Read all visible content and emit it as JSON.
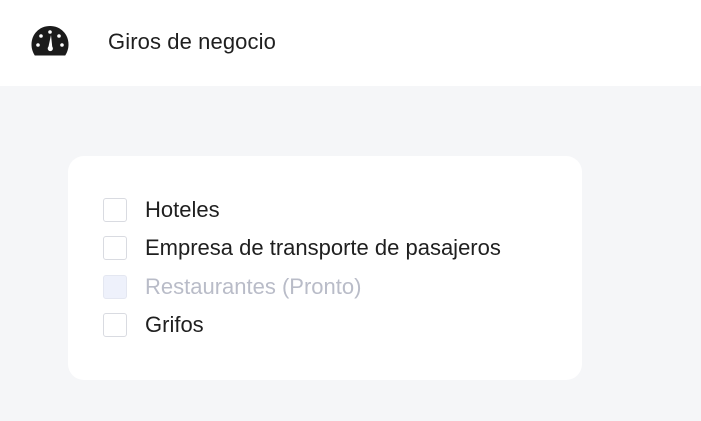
{
  "header": {
    "logo_icon": "speedometer-icon",
    "title": "Giros de negocio"
  },
  "options": [
    {
      "label": "Hoteles",
      "checked": false,
      "disabled": false
    },
    {
      "label": "Empresa de transporte de pasajeros",
      "checked": false,
      "disabled": false
    },
    {
      "label": "Restaurantes (Pronto)",
      "checked": false,
      "disabled": true
    },
    {
      "label": "Grifos",
      "checked": false,
      "disabled": false
    }
  ],
  "colors": {
    "page_background": "#f5f6f8",
    "card_background": "#ffffff",
    "text": "#1f1f1f",
    "disabled_text": "#b9bcc8",
    "disabled_checkbox": "#eef1fb"
  }
}
